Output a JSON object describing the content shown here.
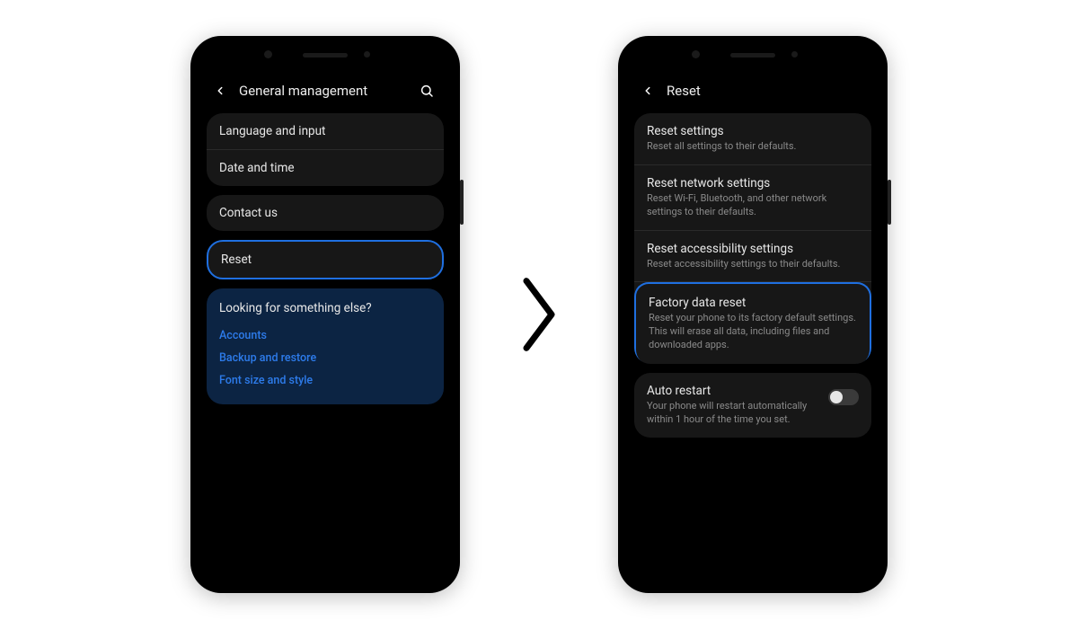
{
  "colors": {
    "accent": "#1f6fe0",
    "link": "#2d7bea",
    "cardBg": "#171717",
    "suggestBg": "#0c2443",
    "textSecondary": "#8a8a8a"
  },
  "left": {
    "header": {
      "title": "General management"
    },
    "items": {
      "language": "Language and input",
      "date": "Date and time",
      "contact": "Contact us",
      "reset": "Reset"
    },
    "suggest": {
      "title": "Looking for something else?",
      "links": {
        "accounts": "Accounts",
        "backup": "Backup and restore",
        "font": "Font size and style"
      }
    }
  },
  "right": {
    "header": {
      "title": "Reset"
    },
    "items": {
      "resetSettings": {
        "title": "Reset settings",
        "sub": "Reset all settings to their defaults."
      },
      "resetNetwork": {
        "title": "Reset network settings",
        "sub": "Reset Wi-Fi, Bluetooth, and other network settings to their defaults."
      },
      "resetAccessibility": {
        "title": "Reset accessibility settings",
        "sub": "Reset accessibility settings to their defaults."
      },
      "factory": {
        "title": "Factory data reset",
        "sub": "Reset your phone to its factory default settings. This will erase all data, including files and downloaded apps."
      },
      "autoRestart": {
        "title": "Auto restart",
        "sub": "Your phone will restart automatically within 1 hour of the time you set."
      }
    },
    "autoRestartOn": false
  }
}
